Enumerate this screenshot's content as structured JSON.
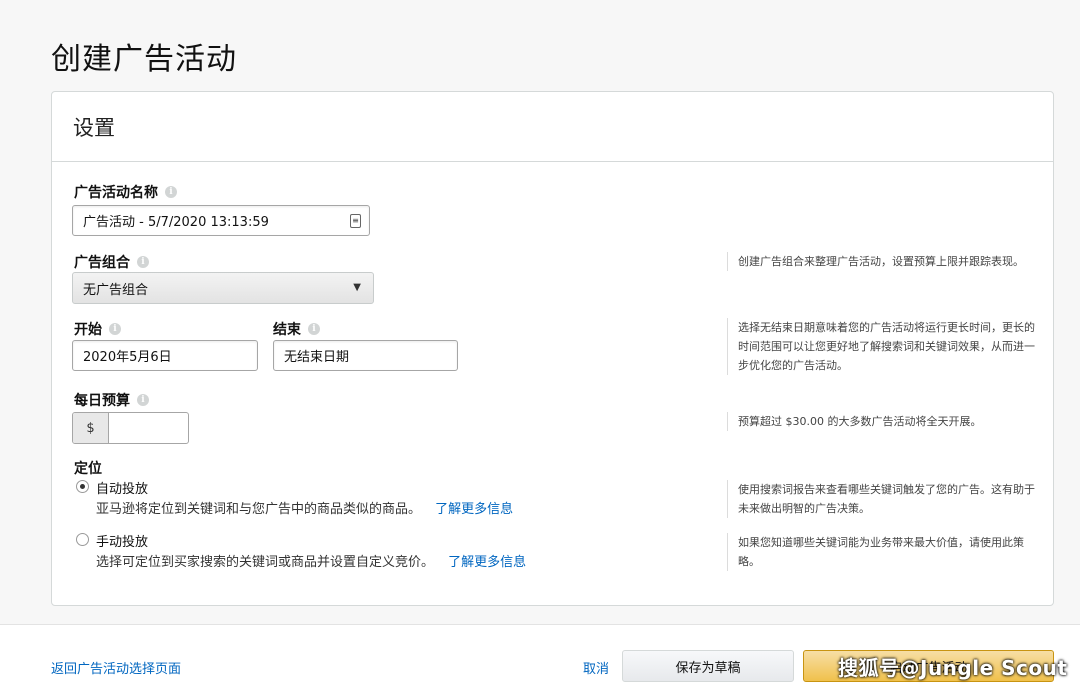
{
  "page": {
    "title": "创建广告活动"
  },
  "settings": {
    "title": "设置",
    "campaign_name": {
      "label": "广告活动名称",
      "value": "广告活动 - 5/7/2020 13:13:59"
    },
    "portfolio": {
      "label": "广告组合",
      "selected": "无广告组合",
      "help": "创建广告组合来整理广告活动，设置预算上限并跟踪表现。"
    },
    "start": {
      "label": "开始",
      "value": "2020年5月6日"
    },
    "end": {
      "label": "结束",
      "value": "无结束日期"
    },
    "dates_help": "选择无结束日期意味着您的广告活动将运行更长时间，更长的时间范围可以让您更好地了解搜索词和关键词效果，从而进一步优化您的广告活动。",
    "daily_budget": {
      "label": "每日预算",
      "currency": "$",
      "value": "",
      "help": "预算超过 $30.00 的大多数广告活动将全天开展。"
    },
    "targeting": {
      "label": "定位",
      "auto": {
        "label": "自动投放",
        "desc": "亚马逊将定位到关键词和与您广告中的商品类似的商品。",
        "link": "了解更多信息",
        "help": "使用搜索词报告来查看哪些关键词触发了您的广告。这有助于未来做出明智的广告决策。",
        "checked": true
      },
      "manual": {
        "label": "手动投放",
        "desc": "选择可定位到买家搜索的关键词或商品并设置自定义竞价。",
        "link": "了解更多信息",
        "help": "如果您知道哪些关键词能为业务带来最大价值，请使用此策略。",
        "checked": false
      }
    }
  },
  "footer": {
    "back_link": "返回广告活动选择页面",
    "cancel": "取消",
    "save_draft": "保存为草稿",
    "launch": "启动广告活动"
  },
  "watermark": "搜狐号@Jungle Scout",
  "icons": {
    "info": "info-icon",
    "calendar": "calendar-icon",
    "chevron": "chevron-down-icon"
  },
  "colors": {
    "link": "#0066c0",
    "primary_button": "#f0c14b"
  }
}
